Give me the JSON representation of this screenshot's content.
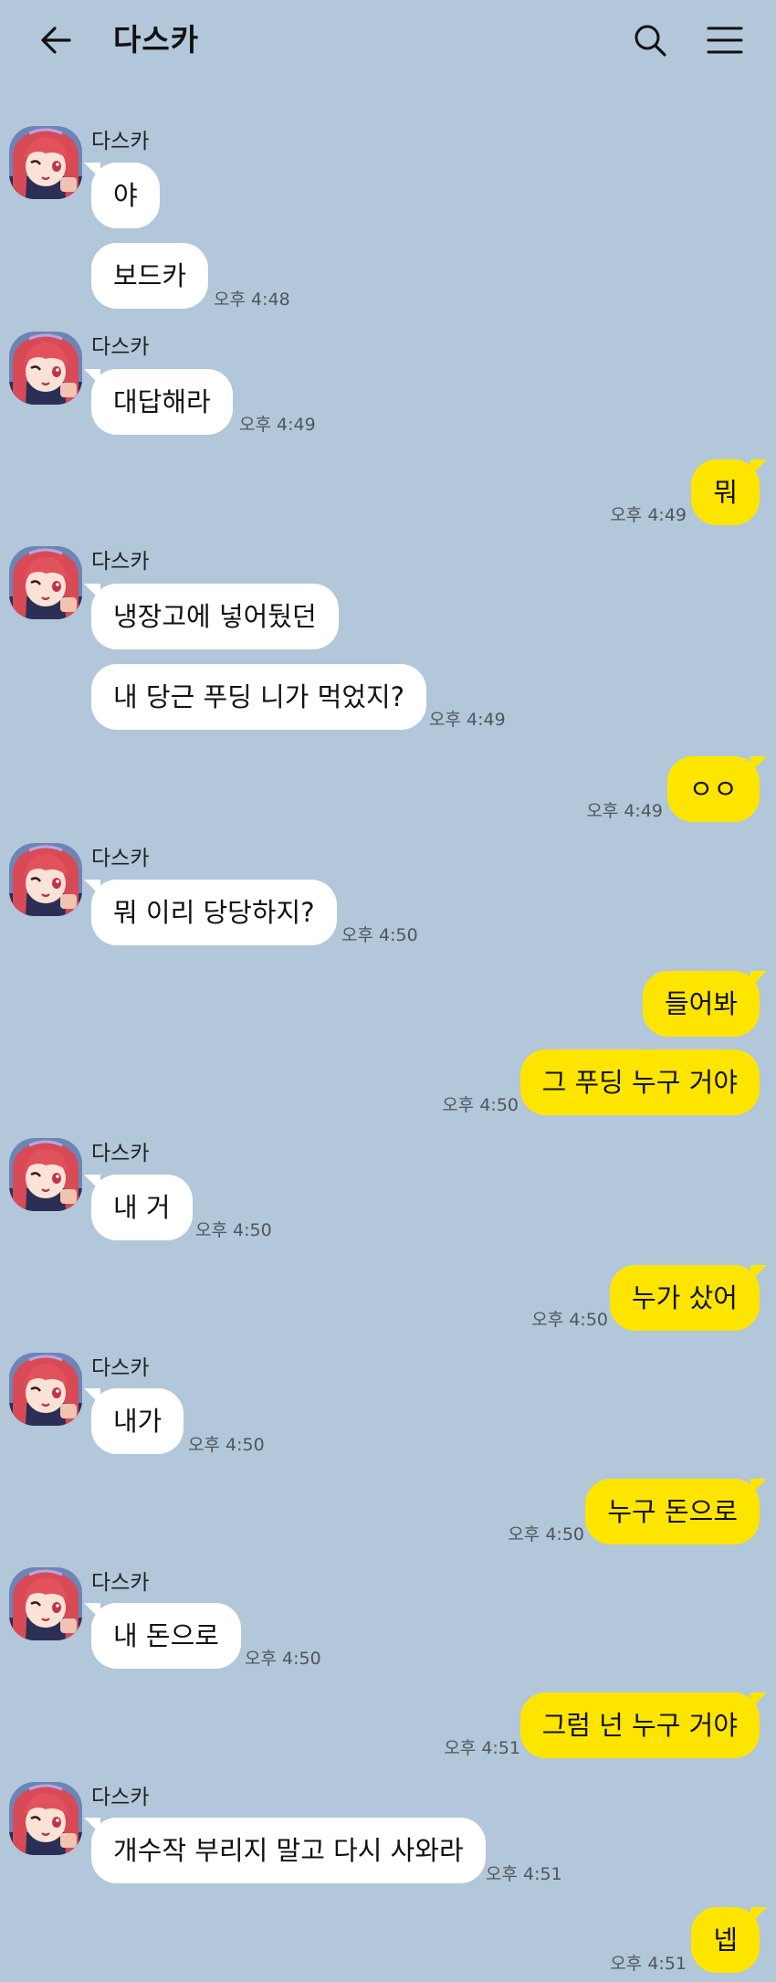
{
  "header": {
    "title": "다스카"
  },
  "chat": {
    "sender_name": "다스카",
    "m1": "야",
    "m2": "보드카",
    "t2": "오후 4:48",
    "m3": "대답해라",
    "t3": "오후 4:49",
    "m4": "뭐",
    "t4": "오후 4:49",
    "m5": "냉장고에 넣어뒀던",
    "m6": "내 당근 푸딩 니가 먹었지?",
    "t6": "오후 4:49",
    "m7": "ㅇㅇ",
    "t7": "오후 4:49",
    "m8": "뭐 이리 당당하지?",
    "t8": "오후 4:50",
    "m9": "들어봐",
    "m10": "그 푸딩 누구 거야",
    "t10": "오후 4:50",
    "m11": "내 거",
    "t11": "오후 4:50",
    "m12": "누가 샀어",
    "t12": "오후 4:50",
    "m13": "내가",
    "t13": "오후 4:50",
    "m14": "누구 돈으로",
    "t14": "오후 4:50",
    "m15": "내 돈으로",
    "t15": "오후 4:50",
    "m16": "그럼 넌 누구 거야",
    "t16": "오후 4:51",
    "m17": "개수작 부리지 말고 다시 사와라",
    "t17": "오후 4:51",
    "m18": "넵",
    "t18": "오후 4:51"
  },
  "colors": {
    "background": "#b2c7da",
    "outgoing": "#fee500",
    "incoming": "#ffffff"
  },
  "icons": {
    "back": "back-arrow-icon",
    "search": "search-icon",
    "menu": "menu-icon",
    "avatar": "avatar-image"
  }
}
